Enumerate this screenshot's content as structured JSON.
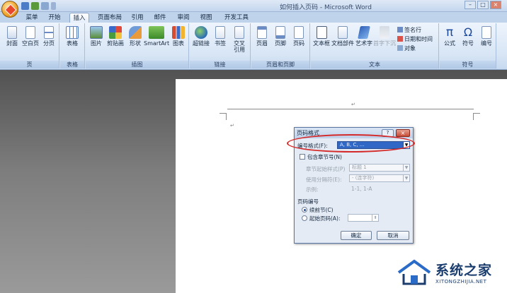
{
  "window": {
    "title": "如何插入页码 - Microsoft Word",
    "controls": [
      "–",
      "□",
      "×"
    ]
  },
  "tabs": [
    {
      "label": "菜单"
    },
    {
      "label": "开始"
    },
    {
      "label": "插入"
    },
    {
      "label": "页面布局"
    },
    {
      "label": "引用"
    },
    {
      "label": "邮件"
    },
    {
      "label": "审阅"
    },
    {
      "label": "视图"
    },
    {
      "label": "开发工具"
    }
  ],
  "ribbon": {
    "groups": {
      "pages": "页",
      "tables": "表格",
      "illustrations": "插图",
      "links": "链接",
      "header_footer": "页眉和页脚",
      "text": "文本",
      "symbols": "符号"
    },
    "buttons": {
      "cover": "封面",
      "blank_page": "空白页",
      "page_break": "分页",
      "table": "表格",
      "picture": "图片",
      "clipart": "剪贴画",
      "shapes": "形状",
      "smartart": "SmartArt",
      "chart": "图表",
      "hyperlink": "超链接",
      "bookmark": "书签",
      "cross_ref_1": "交叉",
      "cross_ref_2": "引用",
      "header": "页眉",
      "footer": "页脚",
      "page_number": "页码",
      "textbox": "文本框",
      "quick_parts": "文档部件",
      "wordart": "艺术字",
      "drop_cap": "首字下沉",
      "signature": "签名行",
      "datetime": "日期和时间",
      "object": "对象",
      "equation": "公式",
      "symbol": "符号",
      "numbering": "编号"
    }
  },
  "document": {
    "para_mark": "↵"
  },
  "dialog": {
    "title": "页码格式",
    "help": "?",
    "close": "×",
    "number_format_label": "编号格式(F):",
    "number_format_value": "A, B, C, ...",
    "include_chapter_label": "包含章节号(N)",
    "chapter_style_label": "章节起始样式(P)",
    "chapter_style_value": "标题 1",
    "separator_label": "使用分隔符(E):",
    "separator_value": "-  (连字符)",
    "example_label": "示例:",
    "example_value": "1-1, 1-A",
    "page_numbering_label": "页码编号",
    "continue_label": "续前节(C)",
    "start_at_label": "起始页码(A):",
    "ok": "确定",
    "cancel": "取消"
  },
  "watermark": {
    "brand": "系统之家",
    "url": "XITONGZHIJIA.NET"
  }
}
